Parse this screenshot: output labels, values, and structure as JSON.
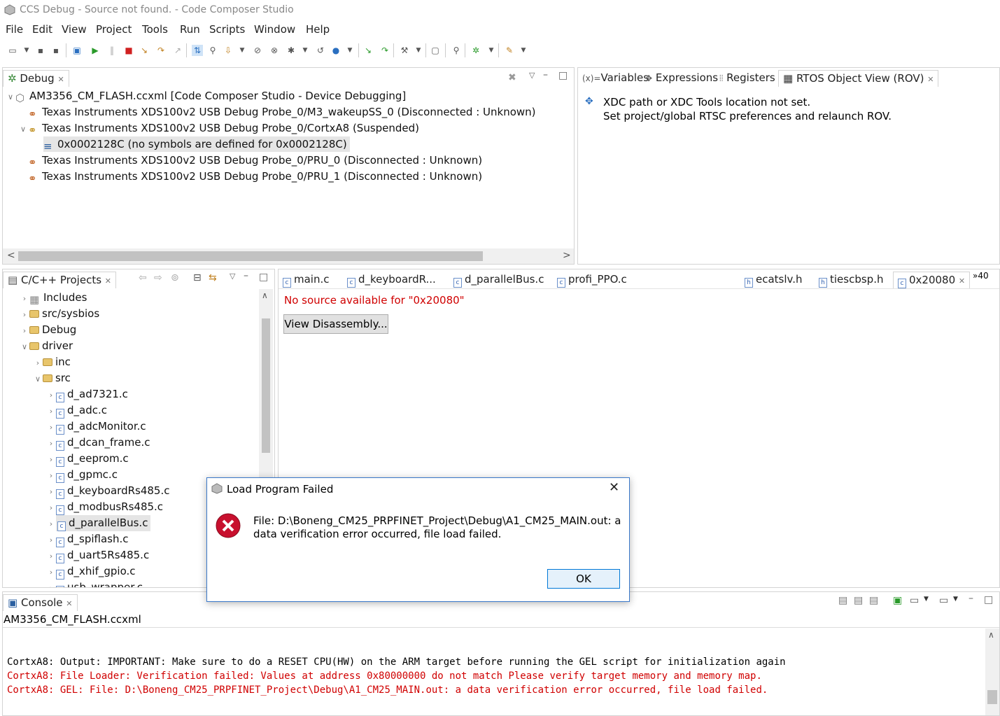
{
  "window": {
    "title": "CCS Debug - Source not found. - Code Composer Studio"
  },
  "menu": [
    "File",
    "Edit",
    "View",
    "Project",
    "Tools",
    "Run",
    "Scripts",
    "Window",
    "Help"
  ],
  "debug_view": {
    "tab_label": "Debug",
    "items": [
      {
        "label": "AM3356_CM_FLASH.ccxml [Code Composer Studio - Device Debugging]"
      },
      {
        "label": "Texas Instruments XDS100v2 USB Debug Probe_0/M3_wakeupSS_0 (Disconnected : Unknown)"
      },
      {
        "label": "Texas Instruments XDS100v2 USB Debug Probe_0/CortxA8 (Suspended)"
      },
      {
        "label": "0x0002128C  (no symbols are defined for 0x0002128C)"
      },
      {
        "label": "Texas Instruments XDS100v2 USB Debug Probe_0/PRU_0 (Disconnected : Unknown)"
      },
      {
        "label": "Texas Instruments XDS100v2 USB Debug Probe_0/PRU_1 (Disconnected : Unknown)"
      }
    ]
  },
  "right_panel": {
    "tabs": [
      "Variables",
      "Expressions",
      "Registers",
      "RTOS Object View (ROV)"
    ],
    "message_line1": "XDC path or XDC Tools location not set.",
    "message_line2": "Set project/global RTSC preferences and relaunch ROV."
  },
  "projects": {
    "tab_label": "C/C++ Projects",
    "items": [
      {
        "label": "Includes"
      },
      {
        "label": "src/sysbios"
      },
      {
        "label": "Debug"
      },
      {
        "label": "driver"
      },
      {
        "label": "inc"
      },
      {
        "label": "src"
      },
      {
        "label": "d_ad7321.c"
      },
      {
        "label": "d_adc.c"
      },
      {
        "label": "d_adcMonitor.c"
      },
      {
        "label": "d_dcan_frame.c"
      },
      {
        "label": "d_eeprom.c"
      },
      {
        "label": "d_gpmc.c"
      },
      {
        "label": "d_keyboardRs485.c"
      },
      {
        "label": "d_modbusRs485.c"
      },
      {
        "label": "d_parallelBus.c"
      },
      {
        "label": "d_spiflash.c"
      },
      {
        "label": "d_uart5Rs485.c"
      },
      {
        "label": "d_xhif_gpio.c"
      },
      {
        "label": "usb_wrapper.c"
      }
    ]
  },
  "editor": {
    "tabs": [
      "main.c",
      "d_keyboardR...",
      "d_parallelBus.c",
      "profi_PPO.c",
      "ecatslv.h",
      "tiescbsp.h",
      "0x20080"
    ],
    "overflow": "»40",
    "no_source": "No source available for \"0x20080\"",
    "disasm_button": "View Disassembly..."
  },
  "console": {
    "tab_label": "Console",
    "header": "AM3356_CM_FLASH.ccxml",
    "lines": [
      {
        "text": "CortxA8: Output: IMPORTANT: Make sure to do a RESET CPU(HW) on the ARM target before running the GEL script for initialization again",
        "color": "#000000"
      },
      {
        "text": "CortxA8: File Loader: Verification failed: Values at address 0x80000000 do not match Please verify target memory and memory map.",
        "color": "#d00000"
      },
      {
        "text": "CortxA8: GEL: File: D:\\Boneng_CM25_PRPFINET_Project\\Debug\\A1_CM25_MAIN.out: a data verification error occurred, file load failed.",
        "color": "#d00000"
      }
    ]
  },
  "dialog": {
    "title": "Load Program Failed",
    "message_line1": "File: D:\\Boneng_CM25_PRPFINET_Project\\Debug\\A1_CM25_MAIN.out: a",
    "message_line2": "data verification error occurred, file load failed.",
    "ok_label": "OK"
  },
  "colors": {
    "error_red": "#d00000",
    "selection": "#e5e5e5",
    "accent": "#3a78c9"
  }
}
